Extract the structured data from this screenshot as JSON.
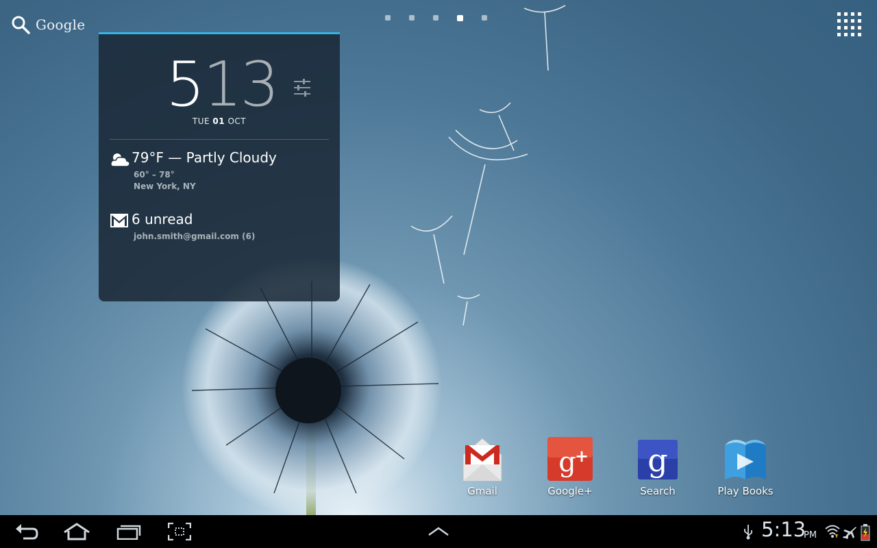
{
  "search": {
    "label": "Google",
    "icon": "search-icon"
  },
  "app_drawer": {
    "icon": "all-apps-grid-icon"
  },
  "pages": {
    "count": 5,
    "active_index": 3
  },
  "widget": {
    "accent_color": "#33b5e5",
    "clock": {
      "hour": "5",
      "minutes": "13"
    },
    "date": {
      "day": "TUE",
      "date": "01",
      "month": "OCT"
    },
    "settings_icon": "tuner-icon",
    "weather": {
      "icon": "partly-cloudy-icon",
      "summary": "79°F — Partly Cloudy",
      "range": "60° – 78°",
      "location": "New York, NY"
    },
    "mail": {
      "icon": "gmail-envelope-icon",
      "unread": "6 unread",
      "account": "john.smith@gmail.com (6)"
    }
  },
  "dock": [
    {
      "label": "Gmail",
      "icon": "gmail-icon"
    },
    {
      "label": "Google+",
      "icon": "google-plus-icon"
    },
    {
      "label": "Search",
      "icon": "google-search-icon"
    },
    {
      "label": "Play Books",
      "icon": "play-books-icon"
    }
  ],
  "navbar": {
    "buttons": [
      "back-icon",
      "home-icon",
      "recent-apps-icon",
      "screenshot-icon",
      "app-tray-up-icon"
    ],
    "status": {
      "time": "5:13",
      "ampm": "PM",
      "icons": [
        "usb-icon",
        "wifi-icon",
        "airplane-icon",
        "battery-charging-icon"
      ]
    }
  }
}
